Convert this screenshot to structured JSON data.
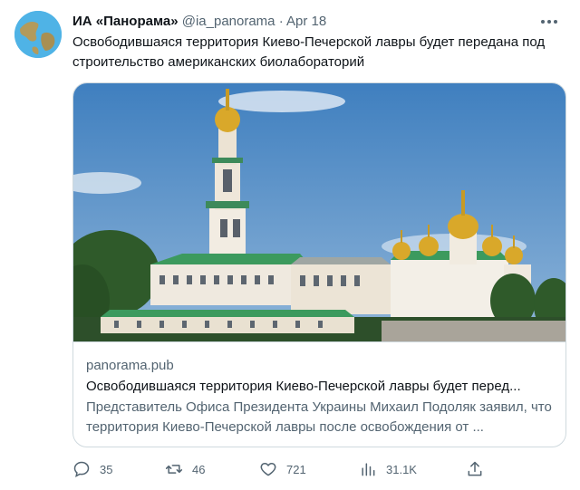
{
  "tweet": {
    "author_name": "ИА «Панорама»",
    "handle": "@ia_panorama",
    "separator": "·",
    "date": "Apr 18",
    "text": "Освободившаяся территория Киево-Печерской лавры будет передана под строительство американских биолабораторий"
  },
  "card": {
    "domain": "panorama.pub",
    "title": "Освободившаяся территория Киево-Печерской лавры будет перед...",
    "description": "Представитель Офиса Президента Украины Михаил Подоляк заявил, что территория Киево-Печерской лавры после освобождения от ..."
  },
  "actions": {
    "replies": "35",
    "retweets": "46",
    "likes": "721",
    "views": "31.1K"
  },
  "colors": {
    "text": "#0f1419",
    "secondary": "#536471",
    "border": "#cfd9de",
    "sky": "#5f93c8",
    "dome_gold": "#d9a82a",
    "roof_green": "#3c9a5e"
  }
}
